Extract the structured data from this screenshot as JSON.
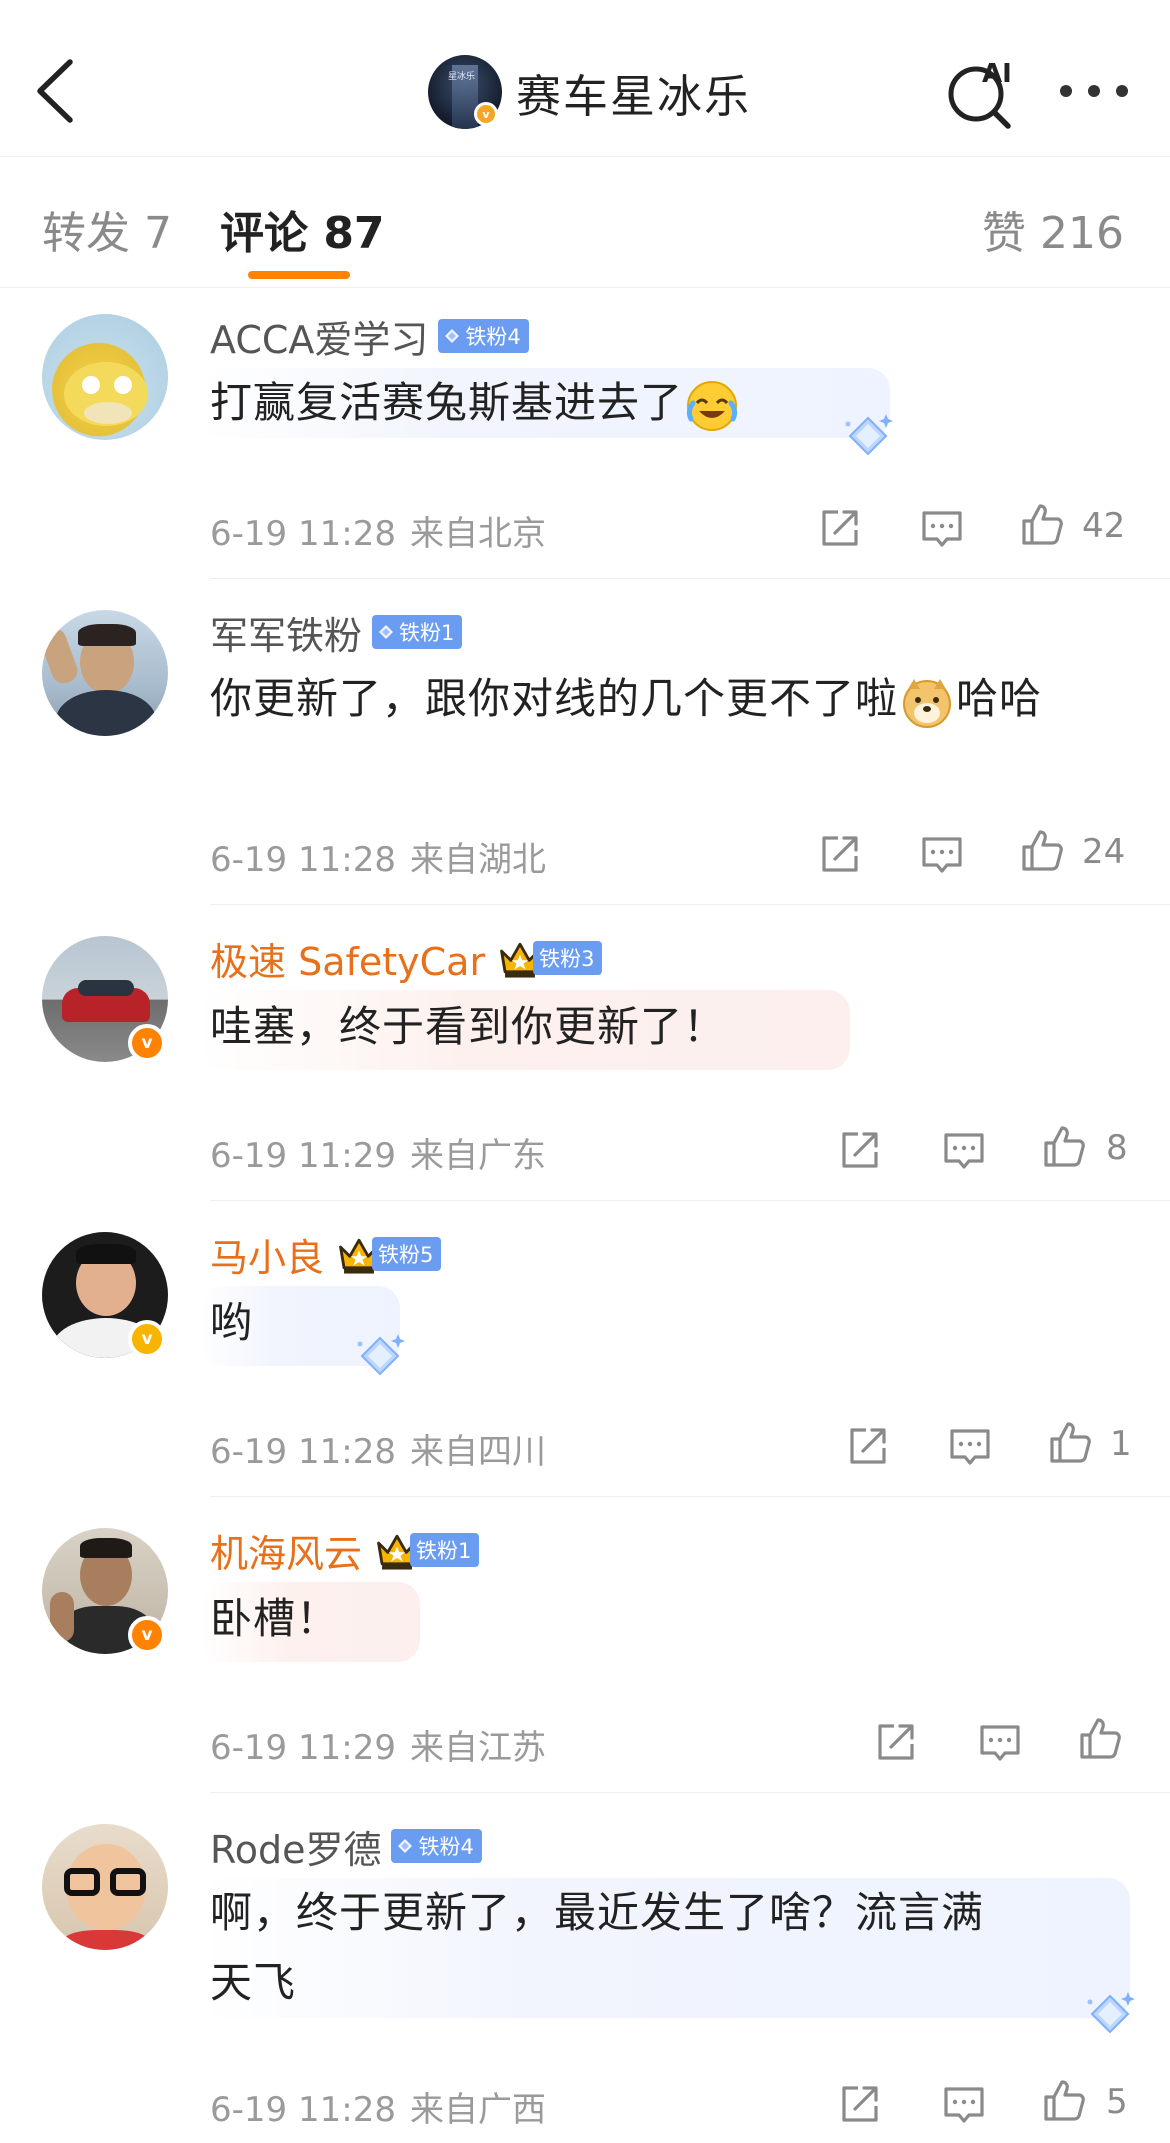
{
  "header": {
    "account_name": "赛车星冰乐",
    "avatar_caption": "星冰乐",
    "ai_label": "AI"
  },
  "tabs": {
    "repost": "转发 7",
    "comments": "评论 87",
    "likes": "赞 216"
  },
  "colors": {
    "accent": "#ff8200",
    "fan_badge": "#6a9cf2",
    "vip_name": "#e8701a"
  },
  "comments": [
    {
      "user": "ACCA爱学习",
      "badge": "铁粉4",
      "text": "打赢复活赛兔斯基进去了",
      "emoji": "laughing-crying-emoji",
      "time": "6-19 11:28",
      "location": "来自北京",
      "likes": "42"
    },
    {
      "user": "军军铁粉",
      "badge": "铁粉1",
      "text": "你更新了，跟你对线的几个更不了啦",
      "emoji": "doge-emoji",
      "text_after": "哈哈",
      "time": "6-19 11:28",
      "location": "来自湖北",
      "likes": "24"
    },
    {
      "user": "极速 SafetyCar",
      "badge": "铁粉3",
      "text": "哇塞，终于看到你更新了！",
      "time": "6-19 11:29",
      "location": "来自广东",
      "likes": "8"
    },
    {
      "user": "马小良",
      "badge": "铁粉5",
      "text": "哟",
      "time": "6-19 11:28",
      "location": "来自四川",
      "likes": "1"
    },
    {
      "user": "机海风云",
      "badge": "铁粉1",
      "text": "卧槽！",
      "time": "6-19 11:29",
      "location": "来自江苏",
      "likes": ""
    },
    {
      "user": "Rode罗德",
      "badge": "铁粉4",
      "text": "啊，终于更新了，最近发生了啥？流言满",
      "text_line2": "天飞",
      "time": "6-19 11:28",
      "location": "来自广西",
      "likes": "5"
    }
  ],
  "icons": {
    "back": "chevron-left-icon",
    "ai_search": "ai-search-icon",
    "more": "more-dots-icon",
    "repost": "share-icon",
    "reply": "comment-icon",
    "like": "thumbs-up-icon",
    "verified": "v-badge-icon",
    "crown": "crown-icon",
    "diamond": "diamond-icon"
  }
}
